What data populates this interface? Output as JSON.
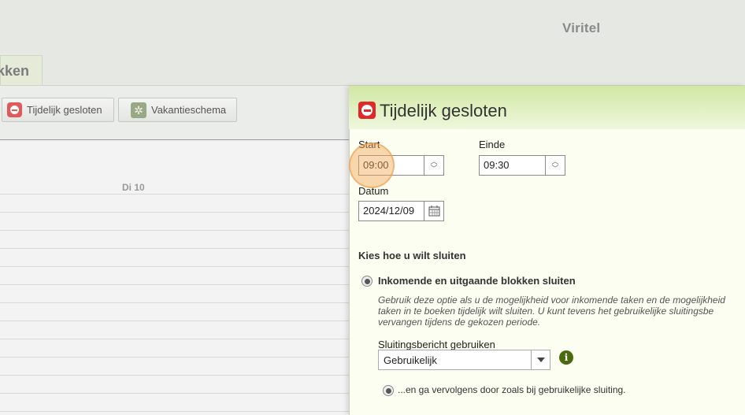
{
  "header": {
    "brand": "Viritel"
  },
  "tab": {
    "label": "kken"
  },
  "toolbar": {
    "closed_label": "Tijdelijk gesloten",
    "vacation_label": "Vakantieschema"
  },
  "calendar": {
    "day_header": "Di 10"
  },
  "dialog": {
    "title": "Tijdelijk gesloten",
    "start_label": "Start",
    "start_value": "09:00",
    "end_label": "Einde",
    "end_value": "09:30",
    "date_label": "Datum",
    "date_value": "2024/12/09",
    "section_title": "Kies hoe u wilt sluiten",
    "option1_label": "Inkomende en uitgaande blokken sluiten",
    "option1_desc_1": "Gebruik deze optie als u de mogelijkheid voor inkomende taken en de mogelijkheid",
    "option1_desc_2": "taken in te boeken tijdelijk wilt sluiten. U kunt tevens het gebruikelijke sluitingsbe",
    "option1_desc_3": "vervangen tijdens de gekozen periode.",
    "closing_msg_label": "Sluitingsbericht gebruiken",
    "closing_msg_value": "Gebruikelijk",
    "sub_option_label": "...en ga vervolgens door zoals bij gebruikelijke sluiting."
  },
  "icons": {
    "closed": "minus-circle-icon",
    "vacation": "gear-icon",
    "info": "info-icon",
    "calendar": "calendar-icon"
  },
  "colors": {
    "accent_green": "#4b6a10",
    "closed_red": "#e02929",
    "panel_bg": "#fbfef0"
  }
}
